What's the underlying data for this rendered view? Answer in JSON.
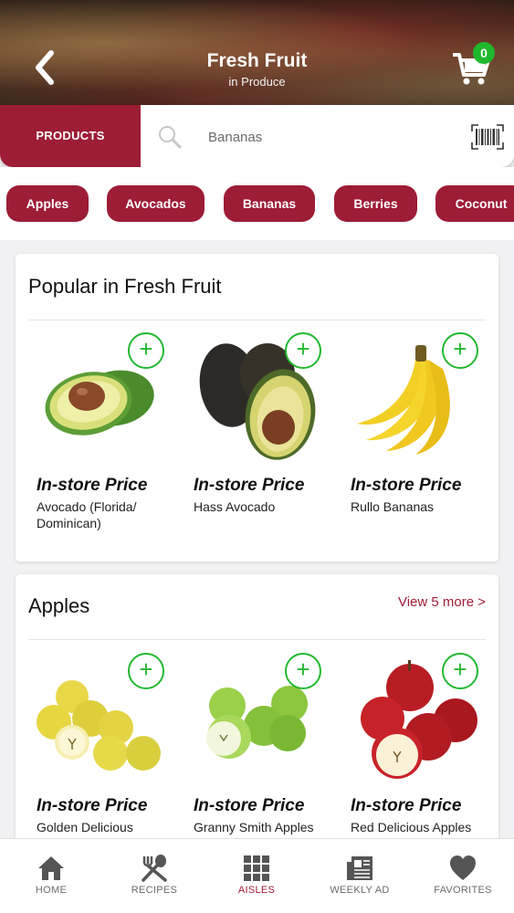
{
  "header": {
    "title": "Fresh Fruit",
    "subtitle": "in Produce",
    "cart_count": "0"
  },
  "search": {
    "tab_label": "PRODUCTS",
    "placeholder": "Bananas"
  },
  "chips": [
    {
      "label": "Apples"
    },
    {
      "label": "Avocados"
    },
    {
      "label": "Bananas"
    },
    {
      "label": "Berries"
    },
    {
      "label": "Coconut"
    }
  ],
  "popular": {
    "title": "Popular in Fresh Fruit",
    "products": [
      {
        "price_label": "In-store Price",
        "name": "Avocado (Florida/ Dominican)",
        "image": "avocado-icon"
      },
      {
        "price_label": "In-store Price",
        "name": "Hass Avocado",
        "image": "hass-avocado-icon"
      },
      {
        "price_label": "In-store Price",
        "name": "Rullo Bananas",
        "image": "bananas-icon"
      }
    ]
  },
  "apples": {
    "title": "Apples",
    "view_more": "View 5 more >",
    "products": [
      {
        "price_label": "In-store Price",
        "name": "Golden Delicious Apples",
        "image": "golden-apples-icon"
      },
      {
        "price_label": "In-store Price",
        "name": "Granny Smith Apples",
        "image": "green-apples-icon"
      },
      {
        "price_label": "In-store Price",
        "name": "Red Delicious Apples",
        "image": "red-apples-icon"
      }
    ]
  },
  "nav": [
    {
      "label": "HOME",
      "icon": "home-icon"
    },
    {
      "label": "RECIPES",
      "icon": "utensils-icon"
    },
    {
      "label": "AISLES",
      "icon": "grid-icon",
      "active": true
    },
    {
      "label": "WEEKLY AD",
      "icon": "newspaper-icon"
    },
    {
      "label": "FAVORITES",
      "icon": "heart-icon"
    }
  ],
  "colors": {
    "brand": "#9d1c36",
    "add_green": "#22b830",
    "badge_green": "#1fb82c"
  }
}
